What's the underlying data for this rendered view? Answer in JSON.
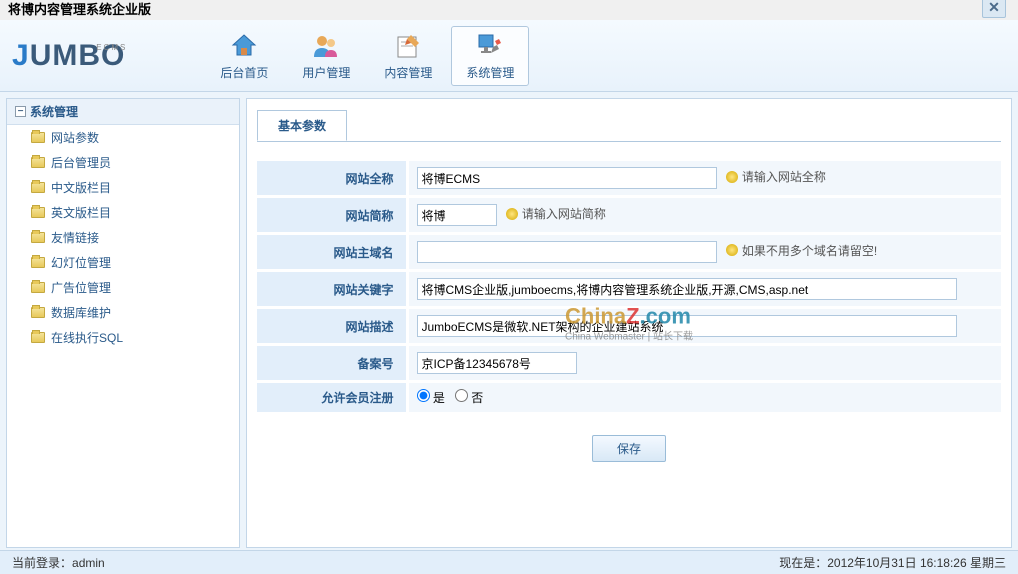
{
  "window": {
    "title": "将博内容管理系统企业版"
  },
  "logo": {
    "text": "JUMBO",
    "subtext": "ECMS"
  },
  "nav": {
    "items": [
      {
        "label": "后台首页",
        "name": "nav-home"
      },
      {
        "label": "用户管理",
        "name": "nav-users"
      },
      {
        "label": "内容管理",
        "name": "nav-content"
      },
      {
        "label": "系统管理",
        "name": "nav-system",
        "active": true
      }
    ]
  },
  "sidebar": {
    "title": "系统管理",
    "items": [
      {
        "label": "网站参数"
      },
      {
        "label": "后台管理员"
      },
      {
        "label": "中文版栏目"
      },
      {
        "label": "英文版栏目"
      },
      {
        "label": "友情链接"
      },
      {
        "label": "幻灯位管理"
      },
      {
        "label": "广告位管理"
      },
      {
        "label": "数据库维护"
      },
      {
        "label": "在线执行SQL"
      }
    ]
  },
  "tab": {
    "label": "基本参数"
  },
  "form": {
    "site_name": {
      "label": "网站全称",
      "value": "将博ECMS",
      "hint": "请输入网站全称"
    },
    "site_short": {
      "label": "网站简称",
      "value": "将博",
      "hint": "请输入网站简称"
    },
    "domain": {
      "label": "网站主域名",
      "value": "",
      "hint": "如果不用多个域名请留空!"
    },
    "keywords": {
      "label": "网站关键字",
      "value": "将博CMS企业版,jumboecms,将博内容管理系统企业版,开源,CMS,asp.net"
    },
    "description": {
      "label": "网站描述",
      "value": "JumboECMS是微软.NET架构的企业建站系统"
    },
    "icp": {
      "label": "备案号",
      "value": "京ICP备12345678号"
    },
    "allow_reg": {
      "label": "允许会员注册",
      "yes": "是",
      "no": "否"
    },
    "save": "保存"
  },
  "status": {
    "login_label": "当前登录：",
    "login_user": "admin",
    "now_label": "现在是：",
    "now_value": "2012年10月31日 16:18:26  星期三"
  },
  "watermark": {
    "line1_a": "China",
    "line1_b": "Z",
    "line1_c": ".com",
    "line2": "China Webmaster | 站长下载"
  }
}
